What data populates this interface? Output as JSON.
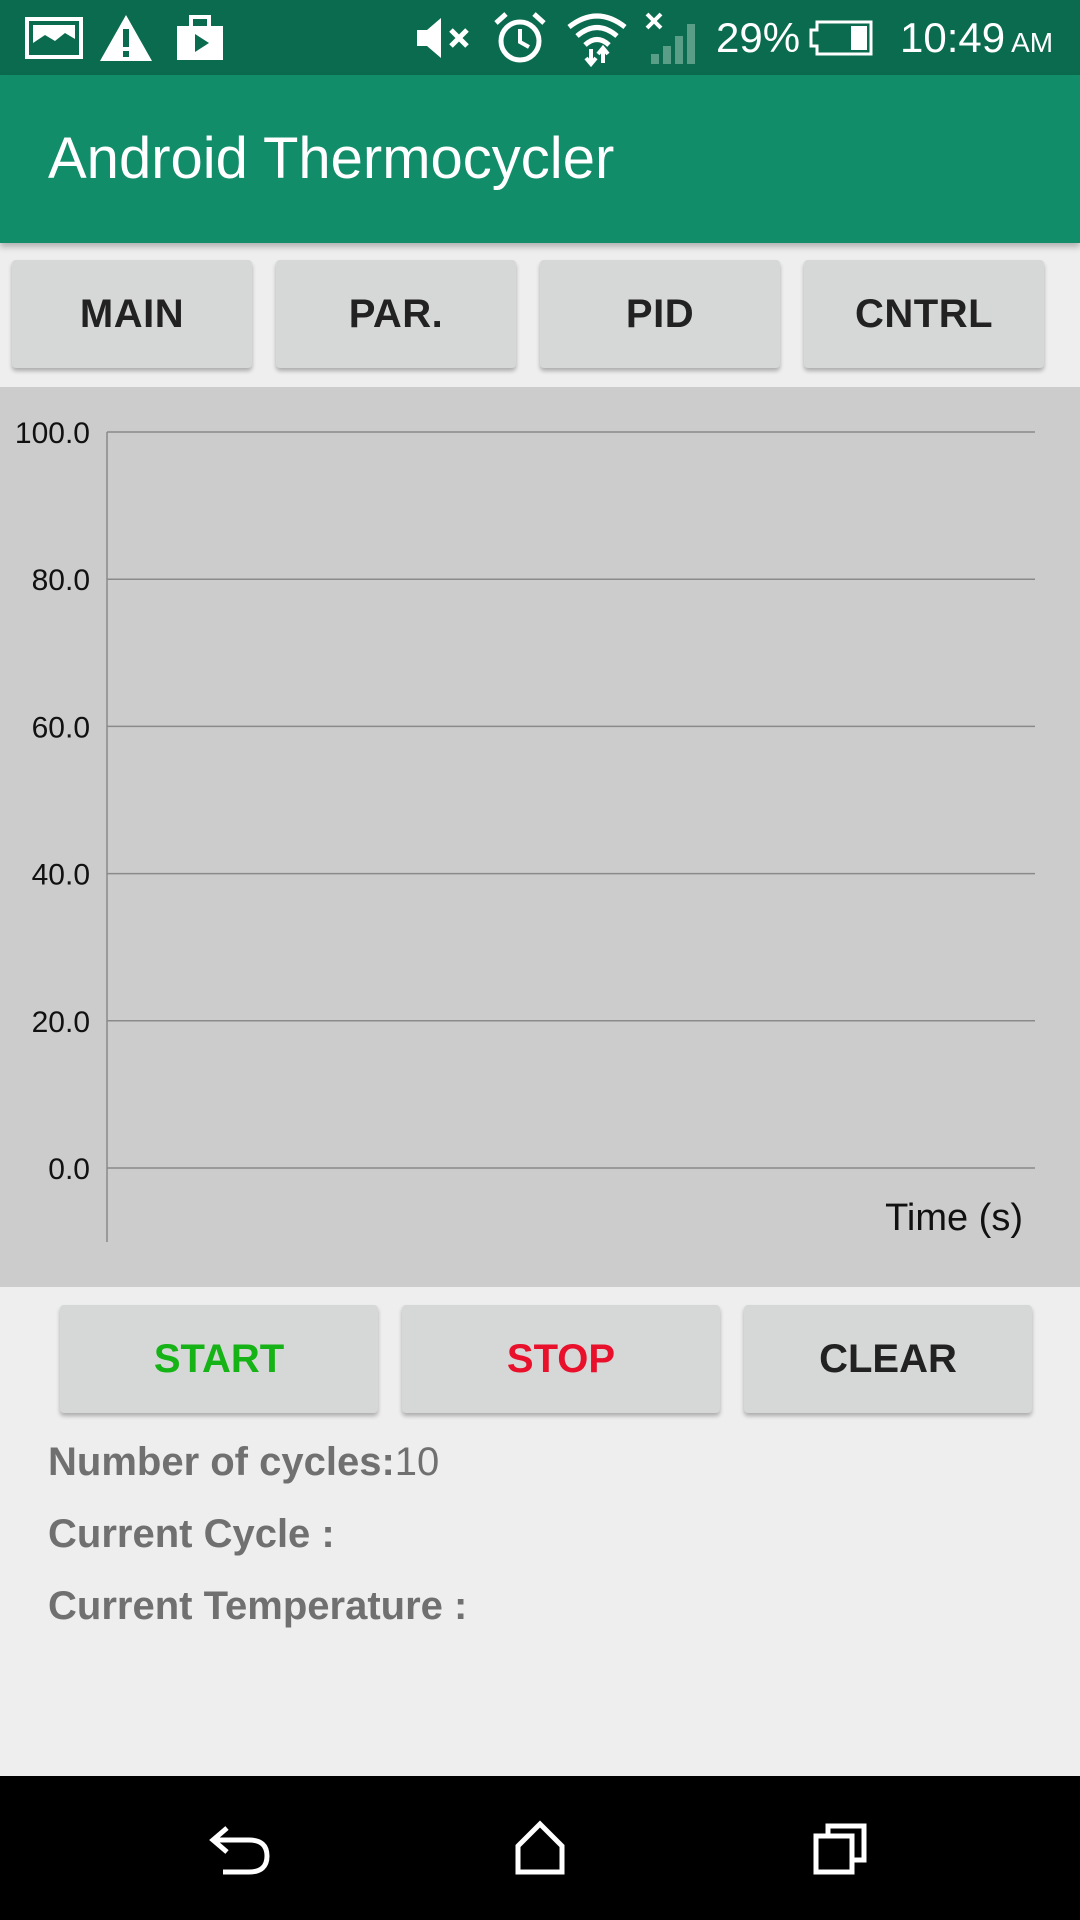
{
  "status_bar": {
    "battery_percent": "29%",
    "time": "10:49",
    "ampm": "AM",
    "icons": [
      "image-icon",
      "warning-icon",
      "briefcase-icon",
      "mute-icon",
      "alarm-icon",
      "wifi-icon",
      "signal-icon",
      "battery-icon"
    ]
  },
  "app_bar": {
    "title": "Android Thermocycler"
  },
  "tabs": [
    {
      "label": "MAIN"
    },
    {
      "label": "PAR."
    },
    {
      "label": "PID"
    },
    {
      "label": "CNTRL"
    }
  ],
  "chart_data": {
    "type": "line",
    "title": "",
    "xlabel": "Time (s)",
    "ylabel": "",
    "ylim": [
      0,
      100
    ],
    "yticks": [
      "100.0",
      "80.0",
      "60.0",
      "40.0",
      "20.0",
      "0.0"
    ],
    "grid": true,
    "series": []
  },
  "controls": {
    "start": {
      "label": "START",
      "color": "#15b315"
    },
    "stop": {
      "label": "STOP",
      "color": "#e8102a"
    },
    "clear": {
      "label": "CLEAR",
      "color": "#222222"
    }
  },
  "info": {
    "cycles_label": "Number of cycles:",
    "cycles_value": "10",
    "current_cycle_label": "Current Cycle :",
    "current_temp_label": "Current Temperature :"
  },
  "colors": {
    "status_bar": "#0b6b4f",
    "app_bar": "#118d6a"
  }
}
